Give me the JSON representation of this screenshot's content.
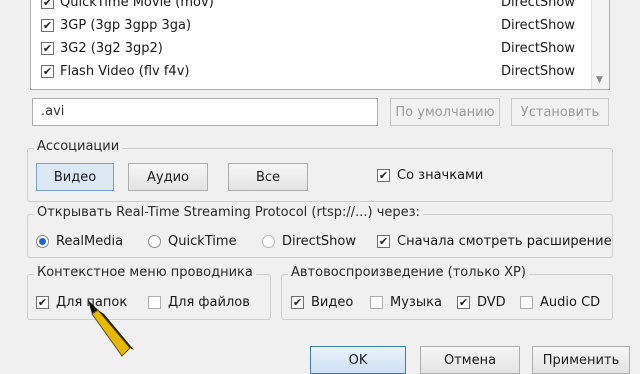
{
  "formats": [
    {
      "name": "QuickTime Movie (mov)",
      "filter": "DirectShow",
      "checked": true
    },
    {
      "name": "3GP (3gp 3gpp 3ga)",
      "filter": "DirectShow",
      "checked": true
    },
    {
      "name": "3G2 (3g2 3gp2)",
      "filter": "DirectShow",
      "checked": true
    },
    {
      "name": "Flash Video (flv f4v)",
      "filter": "DirectShow",
      "checked": true
    }
  ],
  "extension": {
    "value": ".avi",
    "default_label": "По умолчанию",
    "set_label": "Установить"
  },
  "associations": {
    "legend": "Ассоциации",
    "video_label": "Видео",
    "audio_label": "Аудио",
    "all_label": "Все",
    "icons_label": "Со значками",
    "icons_checked": true
  },
  "rtsp": {
    "legend": "Открывать Real-Time Streaming Protocol (rtsp://...) через:",
    "options": [
      "RealMedia",
      "QuickTime",
      "DirectShow"
    ],
    "selected": "RealMedia",
    "preview_label": "Сначала смотреть расширение",
    "preview_checked": true
  },
  "context_menu": {
    "legend": "Контекстное меню проводника",
    "folders_label": "Для папок",
    "folders_checked": true,
    "files_label": "Для файлов",
    "files_checked": false
  },
  "autoplay": {
    "legend": "Автовоспроизведение (только XP)",
    "video_label": "Видео",
    "video_checked": true,
    "music_label": "Музыка",
    "music_checked": false,
    "dvd_label": "DVD",
    "dvd_checked": true,
    "audiocd_label": "Audio CD",
    "audiocd_checked": false
  },
  "dialog": {
    "ok_label": "OK",
    "cancel_label": "Отмена",
    "apply_label": "Применить"
  }
}
